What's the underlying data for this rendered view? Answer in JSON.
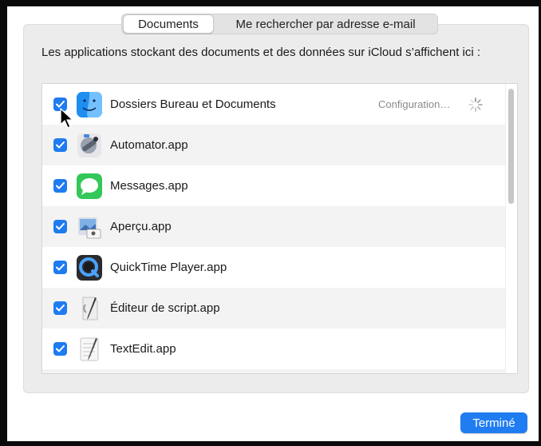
{
  "tabs": [
    {
      "label": "Documents",
      "active": true
    },
    {
      "label": "Me rechercher par adresse e-mail",
      "active": false
    }
  ],
  "description": "Les applications stockant des documents et des données sur iCloud s’affichent ici :",
  "apps": [
    {
      "label": "Dossiers Bureau et Documents",
      "checked": true,
      "icon": "finder-icon",
      "status": "Configuration…"
    },
    {
      "label": "Automator.app",
      "checked": true,
      "icon": "automator-icon"
    },
    {
      "label": "Messages.app",
      "checked": true,
      "icon": "messages-icon"
    },
    {
      "label": "Aperçu.app",
      "checked": true,
      "icon": "preview-icon"
    },
    {
      "label": "QuickTime Player.app",
      "checked": true,
      "icon": "quicktime-icon"
    },
    {
      "label": "Éditeur de script.app",
      "checked": true,
      "icon": "script-editor-icon"
    },
    {
      "label": "TextEdit.app",
      "checked": true,
      "icon": "textedit-icon"
    }
  ],
  "done_button": "Terminé",
  "colors": {
    "accent": "#1f7cf1"
  }
}
